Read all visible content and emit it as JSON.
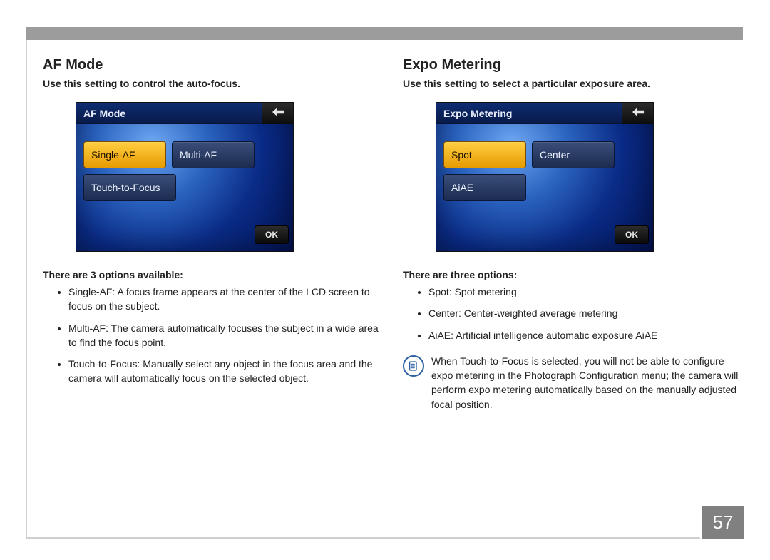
{
  "page_number": "57",
  "left": {
    "title": "AF Mode",
    "lede": "Use this setting to control the auto-focus.",
    "screen": {
      "title": "AF Mode",
      "opt1": "Single-AF",
      "opt2": "Multi-AF",
      "opt3": "Touch-to-Focus",
      "ok": "OK"
    },
    "options_intro": "There are 3 options available:",
    "bullets": {
      "b1": "Single-AF: A focus frame appears at the center of the LCD screen to focus on the subject.",
      "b2": "Multi-AF: The camera automatically focuses the subject in a wide area to find the focus point.",
      "b3": "Touch-to-Focus: Manually select any object in the focus area and the camera will automatically focus on the selected object."
    }
  },
  "right": {
    "title": "Expo Metering",
    "lede": "Use this setting to select a particular exposure area.",
    "screen": {
      "title": "Expo Metering",
      "opt1": "Spot",
      "opt2": "Center",
      "opt3": "AiAE",
      "ok": "OK"
    },
    "options_intro": "There are three options:",
    "bullets": {
      "b1": "Spot: Spot metering",
      "b2": "Center: Center-weighted average metering",
      "b3": "AiAE: Artificial intelligence automatic exposure AiAE"
    },
    "note": "When Touch-to-Focus is selected, you will not be able to configure expo metering in the Photograph Configuration menu; the camera will perform expo metering automatically based on the manually adjusted focal position."
  }
}
